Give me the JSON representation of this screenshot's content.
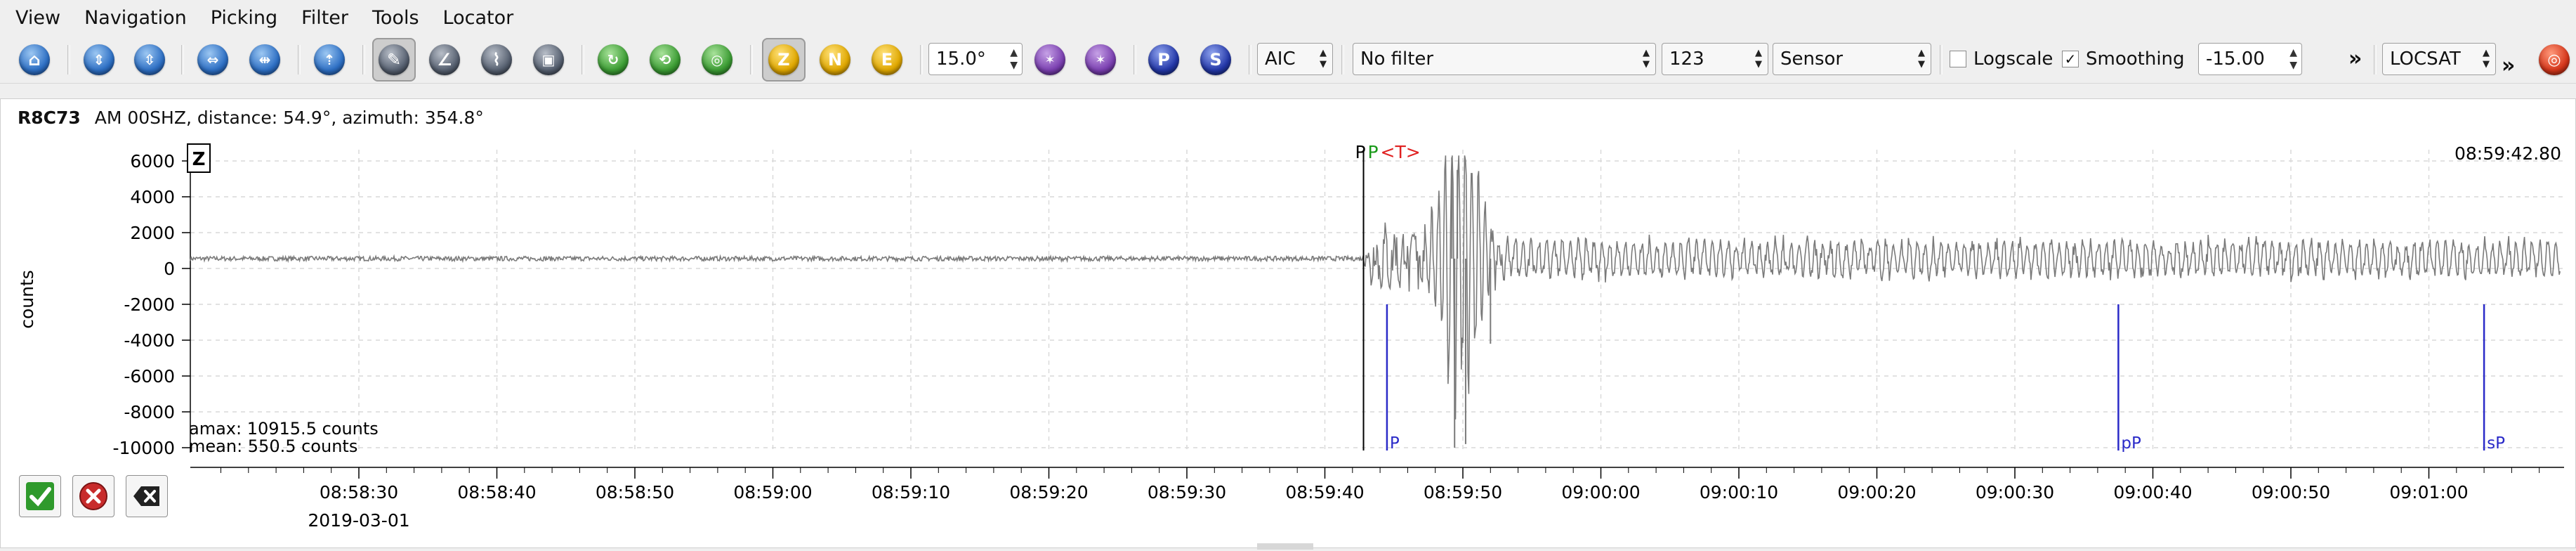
{
  "menu": [
    "View",
    "Navigation",
    "Picking",
    "Filter",
    "Tools",
    "Locator"
  ],
  "toolbar": {
    "icons": [
      "home-icon",
      "scroll-up-icon",
      "scroll-down-icon",
      "scroll-left-icon",
      "scroll-right-icon",
      "zoom-in-icon",
      "pick-tool-icon",
      "angle-tool-icon",
      "spectrum-icon",
      "save-icon",
      "phase-green-icon",
      "phase-red-icon",
      "phase-check-icon"
    ],
    "component_buttons": [
      "Z",
      "N",
      "E"
    ],
    "rotation_value": "15.0°",
    "phase_buttons": [
      "P",
      "S"
    ],
    "picker_method": "AIC",
    "filter": "No filter",
    "filter_number": "123",
    "unit": "Sensor",
    "logscale_label": "Logscale",
    "logscale_checked": false,
    "smoothing_label": "Smoothing",
    "smoothing_checked": true,
    "offset_value": "-15.00",
    "more_label": "»",
    "locator": "LOCSAT",
    "more_label2": "»"
  },
  "trace": {
    "station": "R8C73",
    "info": "AM  00SHZ, distance: 54.9°, azimuth: 354.8°",
    "component_label": "Z",
    "time_label": "08:59:42.80",
    "y_axis_title": "counts",
    "amax": "amax: 10915.5 counts",
    "mean": "mean: 550.5 counts",
    "date": "2019-03-01",
    "picks_top": [
      {
        "label": "P",
        "color": "#000000"
      },
      {
        "label": "P",
        "color": "#1a9a1a"
      },
      {
        "label": "<T>",
        "color": "#e02020"
      }
    ],
    "theoretical_picks": [
      {
        "label": "P",
        "color": "#2a2ac8"
      },
      {
        "label": "pP",
        "color": "#2a2ac8"
      },
      {
        "label": "sP",
        "color": "#2a2ac8"
      }
    ]
  },
  "chart_data": {
    "type": "line",
    "xlabel": "",
    "ylabel": "counts",
    "ylim": [
      -10000,
      6000
    ],
    "y_ticks": [
      "6000",
      "4000",
      "2000",
      "0",
      "-2000",
      "-4000",
      "-6000",
      "-8000",
      "-10000"
    ],
    "x_ticks": [
      "08:58:30",
      "08:58:40",
      "08:58:50",
      "08:59:00",
      "08:59:10",
      "08:59:20",
      "08:59:30",
      "08:59:40",
      "08:59:50",
      "09:00:00",
      "09:00:10",
      "09:00:20",
      "09:00:30",
      "09:00:40",
      "09:00:50",
      "09:01:00"
    ],
    "grid": true,
    "series": [
      {
        "values_description": "seismic waveform: quiet noise near 550 counts before the P arrival (~08:59:43), then strong oscillations peaking near 08:59:49-08:59:51 reaching about +6000 and -10000 counts, followed by coda noise of about ±1000 counts"
      }
    ],
    "marker_times": {
      "P_pick": "08:59:42.8",
      "P_theoretical": "08:59:44.5",
      "pP_theoretical": "09:00:37.5",
      "sP_theoretical": "09:01:04.0"
    }
  }
}
